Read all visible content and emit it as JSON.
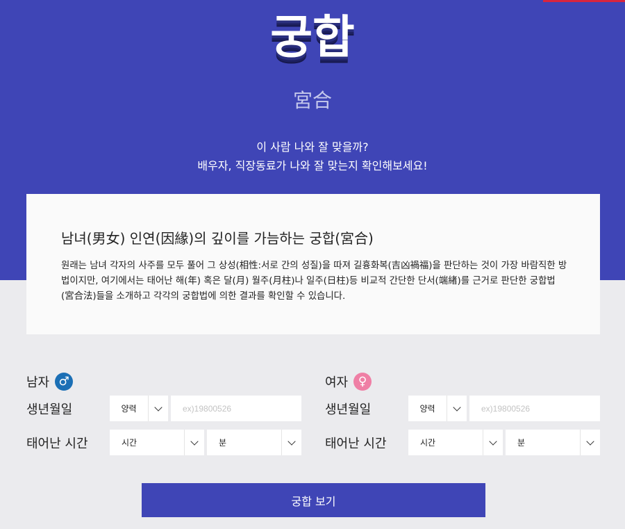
{
  "hero": {
    "title": "궁합",
    "hanja": "宮合",
    "tagline_line1": "이 사람 나와 잘 맞을까?",
    "tagline_line2": "배우자, 직장동료가 나와 잘 맞는지 확인해보세요!"
  },
  "intro": {
    "heading": "남녀(男女) 인연(因緣)의 깊이를 가늠하는 궁합(宮合)",
    "body": "원래는 남녀 각자의 사주를 모두 풀어 그 상성(相性:서로 간의 성질)을 따져 길흉화복(吉凶禍福)을 판단하는 것이 가장 바람직한 방법이지만, 여기에서는 태어난 해(年) 혹은 달(月) 월주(月柱)나 일주(日柱)등 비교적 간단한 단서(端緖)를 근거로 판단한 궁합법(宮合法)들을 소개하고 각각의 궁합법에 의한 결과를 확인할 수 있습니다."
  },
  "male": {
    "label": "남자",
    "icon": "male-symbol-icon",
    "icon_glyph": "♂",
    "badge_color": "#1b6fb5",
    "birth_label": "생년월일",
    "calendar_value": "양력",
    "date_placeholder": "ex)19800526",
    "time_label": "태어난 시간",
    "hour_value": "시간",
    "minute_value": "분"
  },
  "female": {
    "label": "여자",
    "icon": "female-symbol-icon",
    "icon_glyph": "♀",
    "badge_color": "#ef7fa5",
    "birth_label": "생년월일",
    "calendar_value": "양력",
    "date_placeholder": "ex)19800526",
    "time_label": "태어난 시간",
    "hour_value": "시간",
    "minute_value": "분"
  },
  "submit_label": "궁합 보기",
  "colors": {
    "hero_bg": "#3f45b6",
    "page_bg": "#ebebee",
    "button_bg": "#3f45b6",
    "accent_red": "#d8253f"
  }
}
